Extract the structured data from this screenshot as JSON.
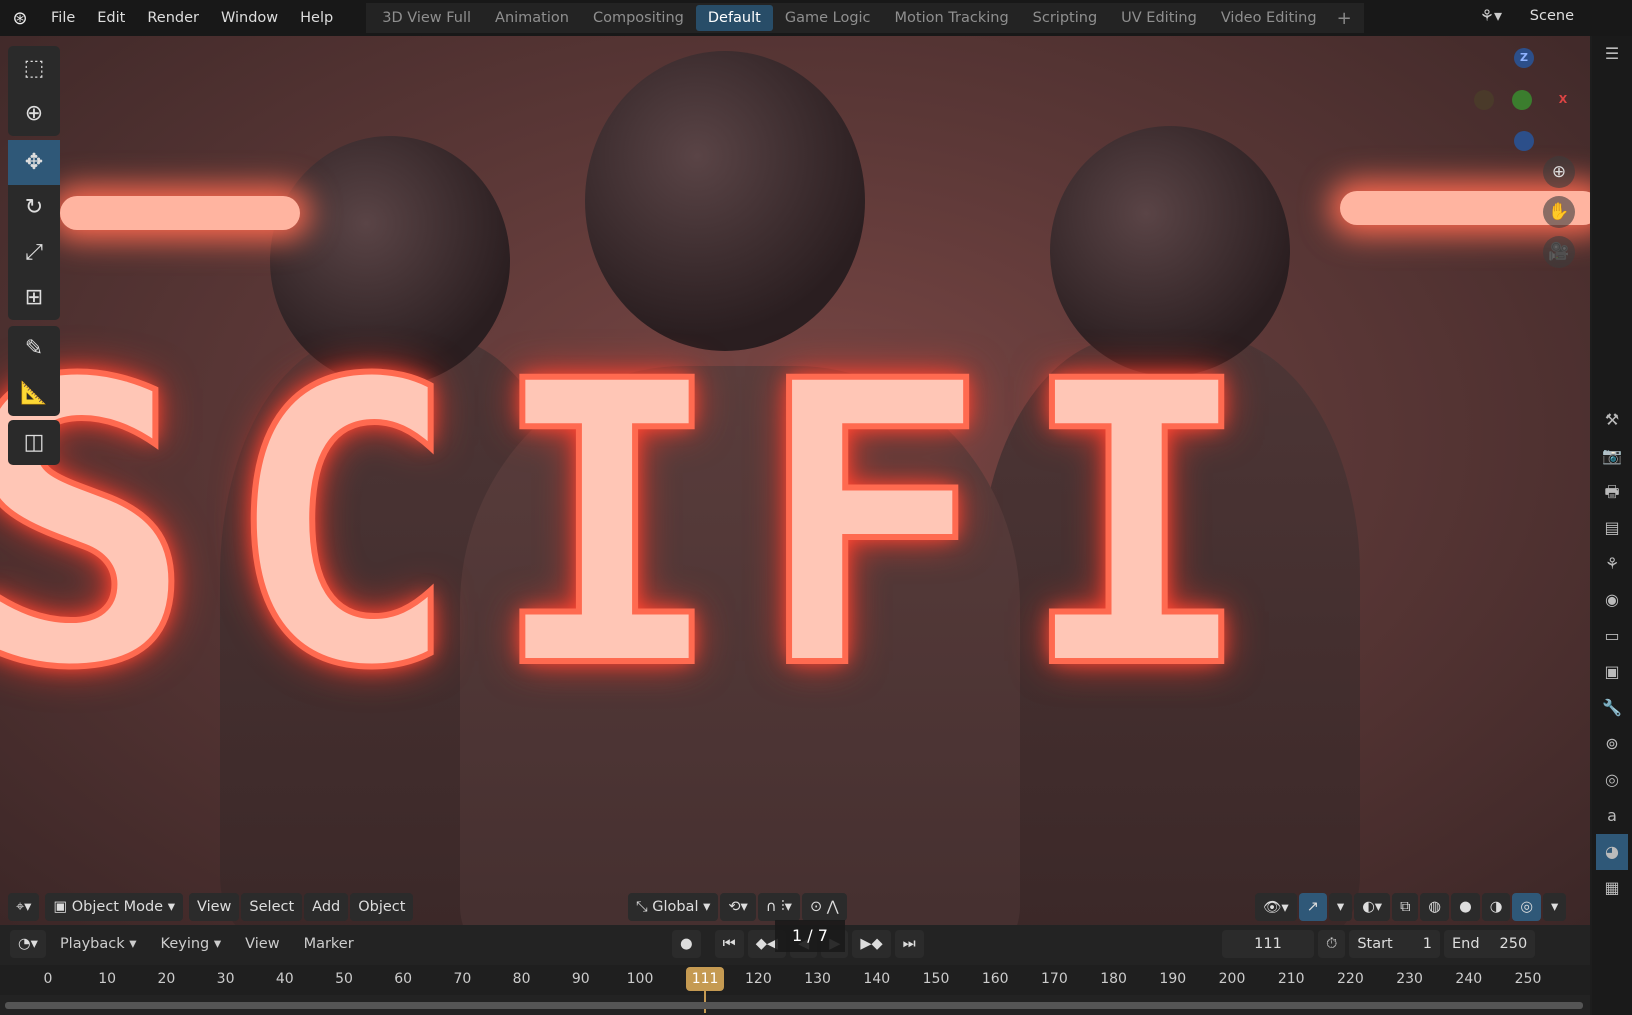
{
  "menu": {
    "items": [
      "File",
      "Edit",
      "Render",
      "Window",
      "Help"
    ]
  },
  "workspaces": {
    "tabs": [
      "3D View Full",
      "Animation",
      "Compositing",
      "Default",
      "Game Logic",
      "Motion Tracking",
      "Scripting",
      "UV Editing",
      "Video Editing"
    ],
    "active": "Default",
    "add": "+"
  },
  "scene": {
    "label": "Scene"
  },
  "viewport": {
    "scene_text": "SCIFI",
    "gizmo": {
      "z": "Z",
      "x": "X"
    },
    "header": {
      "mode": "Object Mode",
      "menus": [
        "View",
        "Select",
        "Add",
        "Object"
      ],
      "orientation": "Global"
    }
  },
  "timeline": {
    "menus": {
      "playback": "Playback",
      "keying": "Keying",
      "view": "View",
      "marker": "Marker"
    },
    "current_frame": "111",
    "start_label": "Start",
    "start": "1",
    "end_label": "End",
    "end": "250",
    "ticks": [
      "0",
      "10",
      "20",
      "30",
      "40",
      "50",
      "60",
      "70",
      "80",
      "90",
      "100",
      "120",
      "130",
      "140",
      "150",
      "160",
      "170",
      "180",
      "190",
      "200",
      "210",
      "220",
      "230",
      "240",
      "250"
    ],
    "overlay": "1 / 7"
  },
  "colors": {
    "accent": "#2f5878",
    "playhead": "#c59a52",
    "neon": "#ff4a35"
  }
}
